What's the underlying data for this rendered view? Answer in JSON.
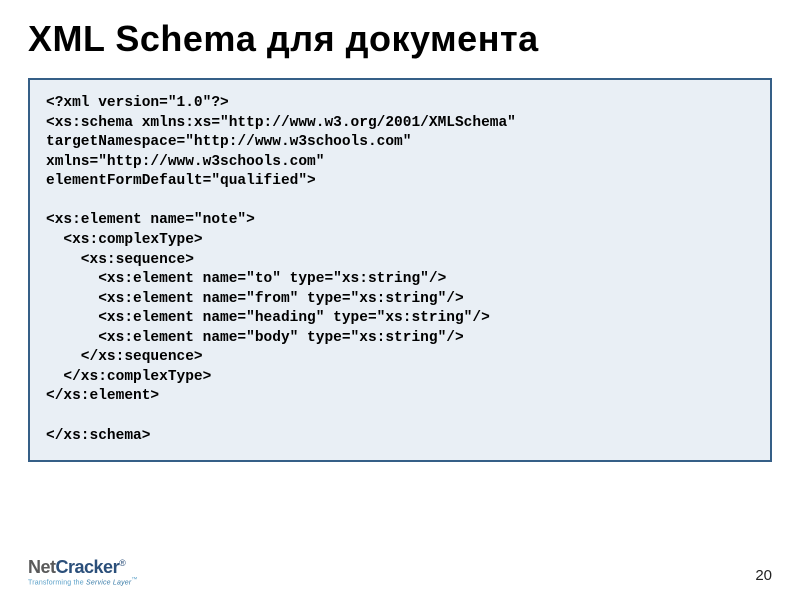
{
  "title": "XML Schema для документа",
  "code": "<?xml version=\"1.0\"?>\n<xs:schema xmlns:xs=\"http://www.w3.org/2001/XMLSchema\"\ntargetNamespace=\"http://www.w3schools.com\"\nxmlns=\"http://www.w3schools.com\"\nelementFormDefault=\"qualified\">\n\n<xs:element name=\"note\">\n  <xs:complexType>\n    <xs:sequence>\n      <xs:element name=\"to\" type=\"xs:string\"/>\n      <xs:element name=\"from\" type=\"xs:string\"/>\n      <xs:element name=\"heading\" type=\"xs:string\"/>\n      <xs:element name=\"body\" type=\"xs:string\"/>\n    </xs:sequence>\n  </xs:complexType>\n</xs:element>\n\n</xs:schema>",
  "logo": {
    "net": "Net",
    "cracker": "Cracker",
    "reg": "®",
    "tag_prefix": "Transforming the ",
    "tag_layer": "Service Layer",
    "tag_tm": "™"
  },
  "page_number": "20"
}
